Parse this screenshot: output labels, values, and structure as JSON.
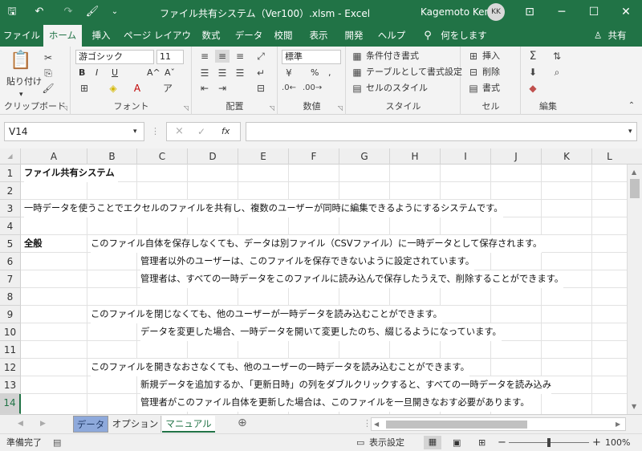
{
  "titlebar": {
    "title": "ファイル共有システム（Ver100）.xlsm  -  Excel",
    "user": "Kagemoto Kenji",
    "initials": "KK",
    "quick_access": {
      "save": "🖫",
      "undo": "↶",
      "redo": "↷",
      "brush": "🖌",
      "more": "⌄"
    },
    "window": {
      "ribbon_options": "⊡",
      "minimize": "─",
      "maximize": "☐",
      "close": "✕"
    }
  },
  "tabs": [
    "ファイル",
    "ホーム",
    "挿入",
    "ページ レイアウト",
    "数式",
    "データ",
    "校閲",
    "表示",
    "開発",
    "ヘルプ",
    "何をしますか"
  ],
  "share": "共有",
  "ribbon": {
    "clipboard": {
      "label": "クリップボード",
      "paste": "貼り付け"
    },
    "font": {
      "label": "フォント",
      "name": "游ゴシック",
      "size": "11",
      "bold": "B",
      "italic": "I",
      "underline": "U",
      "grow": "A^",
      "shrink": "Aˇ"
    },
    "alignment": {
      "label": "配置"
    },
    "number": {
      "label": "数値",
      "format": "標準",
      "percent": "%",
      "comma": ","
    },
    "styles": {
      "label": "スタイル",
      "conditional": "条件付き書式",
      "table": "テーブルとして書式設定",
      "cell_styles": "セルのスタイル"
    },
    "cells": {
      "label": "セル",
      "insert": "挿入",
      "delete": "削除",
      "format": "書式"
    },
    "editing": {
      "label": "編集"
    }
  },
  "formula_bar": {
    "name_box": "V14",
    "fx": "fx",
    "cancel": "×",
    "enter": "✓",
    "content": ""
  },
  "columns": [
    "A",
    "B",
    "C",
    "D",
    "E",
    "F",
    "G",
    "H",
    "I",
    "J",
    "K",
    "L"
  ],
  "rows": [
    "1",
    "2",
    "3",
    "4",
    "5",
    "6",
    "7",
    "8",
    "9",
    "10",
    "11",
    "12",
    "13",
    "14"
  ],
  "cells": {
    "r1a": "ファイル共有システム",
    "r3a": "一時データを使うことでエクセルのファイルを共有し、複数のユーザーが同時に編集できるようにするシステムです。",
    "r5a": "全般",
    "r5b": "このファイル自体を保存しなくても、データは別ファイル（CSVファイル）に一時データとして保存されます。",
    "r6c": "管理者以外のユーザーは、このファイルを保存できないように設定されています。",
    "r7c": "管理者は、すべての一時データをこのファイルに読み込んで保存したうえで、削除することができます。",
    "r9b": "このファイルを閉じなくても、他のユーザーが一時データを読み込むことができます。",
    "r10c": "データを変更した場合、一時データを開いて変更したのち、綴じるようになっています。",
    "r12b": "このファイルを開きなおさなくても、他のユーザーの一時データを読み込むことができます。",
    "r13c": "新規データを追加するか、「更新日時」の列をダブルクリックすると、すべての一時データを読み込み",
    "r14c": "管理者がこのファイル自体を更新した場合は、このファイルを一旦開きなおす必要があります。"
  },
  "sheets": [
    "データ",
    "オプション",
    "マニュアル"
  ],
  "status": {
    "ready": "準備完了",
    "display_settings": "表示設定",
    "zoom": "100%",
    "zoom_in": "+",
    "zoom_out": "−"
  }
}
